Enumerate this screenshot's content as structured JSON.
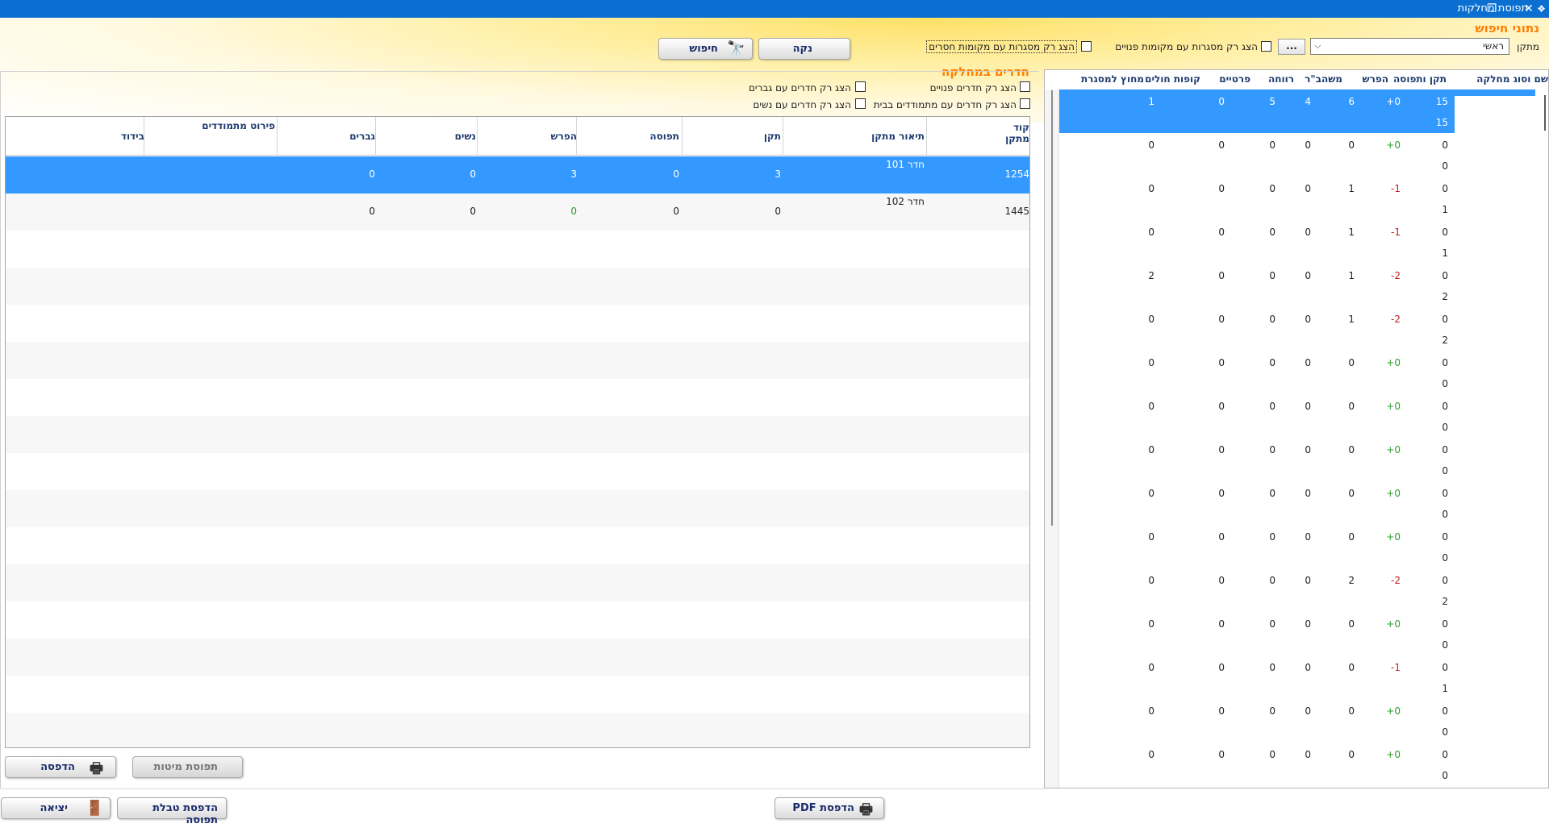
{
  "window": {
    "title": "תפוסת מחלקות",
    "restore_icon": "restore-icon",
    "close_icon": "close-icon"
  },
  "search": {
    "title": "נתוני חיפוש",
    "facility_label": "מתקן",
    "facility_value": "ראשי",
    "ellipsis": "...",
    "chk_free_label": "הצג רק מסגרות עם מקומות פנויים",
    "chk_missing_label": "הצג רק מסגרות עם מקומות חסרים",
    "clear_label": "נקה",
    "search_label": "חיפוש"
  },
  "rooms": {
    "title": "חדרים במחלקה",
    "chk_free": "הצג רק חדרים פנויים",
    "chk_men": "הצג רק חדרים עם גברים",
    "chk_home": "הצג רק חדרים עם מתמודדים בבית",
    "chk_women": "הצג רק חדרים עם נשים"
  },
  "right_grid": {
    "headers": [
      "שם וסוג מחלקה",
      "תקן ותפוסה",
      "הפרש",
      "משהב\"ר",
      "רווחה",
      "פרטיים",
      "קופות חולים",
      "מחוץ למסגרת"
    ],
    "rows": [
      {
        "a": "15",
        "b": "15",
        "diff": "+0",
        "c": "6",
        "d": "4",
        "e": "5",
        "f": "0",
        "g": "1",
        "sel": true
      },
      {
        "a": "0",
        "b": "0",
        "diff": "+0",
        "c": "0",
        "d": "0",
        "e": "0",
        "f": "0",
        "g": "0"
      },
      {
        "a": "0",
        "b": "1",
        "diff": "-1",
        "c": "1",
        "d": "0",
        "e": "0",
        "f": "0",
        "g": "0"
      },
      {
        "a": "0",
        "b": "1",
        "diff": "-1",
        "c": "1",
        "d": "0",
        "e": "0",
        "f": "0",
        "g": "0"
      },
      {
        "a": "0",
        "b": "2",
        "diff": "-2",
        "c": "1",
        "d": "0",
        "e": "0",
        "f": "0",
        "g": "2"
      },
      {
        "a": "0",
        "b": "2",
        "diff": "-2",
        "c": "1",
        "d": "0",
        "e": "0",
        "f": "0",
        "g": "0"
      },
      {
        "a": "0",
        "b": "0",
        "diff": "+0",
        "c": "0",
        "d": "0",
        "e": "0",
        "f": "0",
        "g": "0"
      },
      {
        "a": "0",
        "b": "0",
        "diff": "+0",
        "c": "0",
        "d": "0",
        "e": "0",
        "f": "0",
        "g": "0"
      },
      {
        "a": "0",
        "b": "0",
        "diff": "+0",
        "c": "0",
        "d": "0",
        "e": "0",
        "f": "0",
        "g": "0"
      },
      {
        "a": "0",
        "b": "0",
        "diff": "+0",
        "c": "0",
        "d": "0",
        "e": "0",
        "f": "0",
        "g": "0"
      },
      {
        "a": "0",
        "b": "0",
        "diff": "+0",
        "c": "0",
        "d": "0",
        "e": "0",
        "f": "0",
        "g": "0"
      },
      {
        "a": "0",
        "b": "2",
        "diff": "-2",
        "c": "2",
        "d": "0",
        "e": "0",
        "f": "0",
        "g": "0"
      },
      {
        "a": "0",
        "b": "0",
        "diff": "+0",
        "c": "0",
        "d": "0",
        "e": "0",
        "f": "0",
        "g": "0"
      },
      {
        "a": "0",
        "b": "1",
        "diff": "-1",
        "c": "0",
        "d": "0",
        "e": "0",
        "f": "0",
        "g": "0"
      },
      {
        "a": "0",
        "b": "0",
        "diff": "+0",
        "c": "0",
        "d": "0",
        "e": "0",
        "f": "0",
        "g": "0"
      },
      {
        "a": "0",
        "b": "0",
        "diff": "+0",
        "c": "0",
        "d": "0",
        "e": "0",
        "f": "0",
        "g": "0"
      }
    ]
  },
  "main_grid": {
    "headers": {
      "code_line1": "קוד",
      "code_line2": "מתקן",
      "desc": "תיאור מתקן",
      "standard": "תקן",
      "occupancy": "תפוסה",
      "diff": "הפרש",
      "women": "נשים",
      "men": "גברים",
      "breakdown": "פירוט מתמודדים",
      "isolation": "בידוד"
    },
    "rows": [
      {
        "code": "1254",
        "desc": "חדר 101",
        "standard": "3",
        "occupancy": "0",
        "diff": "3",
        "women": "0",
        "men": "0",
        "sel": true
      },
      {
        "code": "1445",
        "desc": "חדר 102",
        "standard": "0",
        "occupancy": "0",
        "diff": "0",
        "women": "0",
        "men": "0",
        "sel": false
      }
    ]
  },
  "buttons": {
    "print": "הדפסה",
    "beds": "תפוסת מיטות",
    "exit": "יציאה",
    "print_table": "הדפסת טבלת תפוסה",
    "pdf": "הדפסת PDF"
  },
  "colors": {
    "title_bar": "#0a6fd1",
    "accent_orange": "#ff7e00",
    "header_text": "#1d3a6e",
    "selection": "#3399ff",
    "positive": "#2e9e2e",
    "negative": "#d01818"
  }
}
